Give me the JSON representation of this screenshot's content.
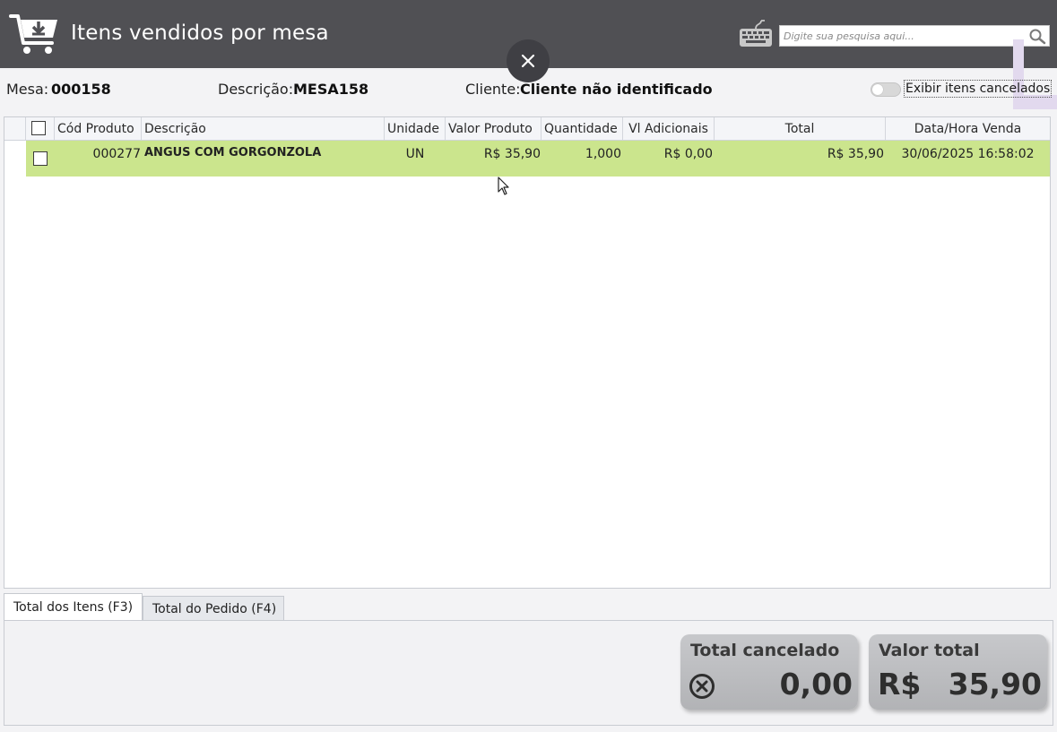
{
  "window": {
    "title": "Itens vendidos por mesa",
    "icons": {
      "title": "shopping-cart-download-icon",
      "keyboard": "keyboard-icon",
      "search": "search-icon",
      "close": "close-icon"
    }
  },
  "search": {
    "placeholder": "Digite sua pesquisa aqui...",
    "value": ""
  },
  "info": {
    "mesa_label": "Mesa:",
    "mesa_value": "000158",
    "descricao_label": "Descrição:",
    "descricao_value": "MESA158",
    "cliente_label": "Cliente:",
    "cliente_value": "Cliente não identificado",
    "toggle_label": "Exibir itens cancelados",
    "toggle_on": false
  },
  "table": {
    "columns": [
      "Cód Produto",
      "Descrição",
      "Unidade",
      "Valor Produto",
      "Quantidade",
      "Vl Adicionais",
      "Total",
      "Data/Hora Venda"
    ],
    "rows": [
      {
        "codigo": "000277",
        "descricao": "ANGUS COM GORGONZOLA",
        "unidade": "UN",
        "valor_produto": "R$ 35,90",
        "quantidade": "1,000",
        "vl_adicionais": "R$ 0,00",
        "total": "R$ 35,90",
        "data_hora": "30/06/2025 16:58:02",
        "selected": true
      }
    ]
  },
  "tabs": [
    {
      "label": "Total dos Itens (F3)",
      "active": true
    },
    {
      "label": "Total do Pedido (F4)",
      "active": false
    }
  ],
  "totals": {
    "cancelado_label": "Total cancelado",
    "cancelado_value": "0,00",
    "cancelado_icon": "cancel-circle-icon",
    "valor_label": "Valor total",
    "valor_currency": "R$",
    "valor_value": "35,90"
  },
  "colors": {
    "titlebar": "#505054",
    "selected_row": "#cbe58d",
    "accent_purple": "#d9cfe6"
  }
}
